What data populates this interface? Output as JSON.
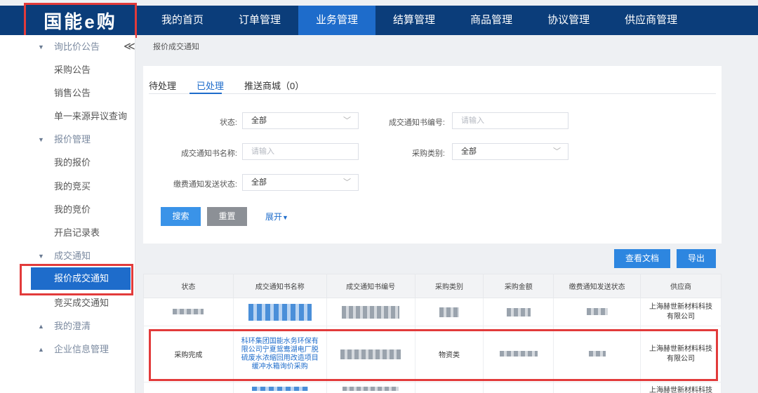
{
  "brand": {
    "logo_text": "国能e购"
  },
  "nav": {
    "items": [
      "我的首页",
      "订单管理",
      "业务管理",
      "结算管理",
      "商品管理",
      "协议管理",
      "供应商管理"
    ],
    "active_index": 2
  },
  "sidebar": {
    "collapse_glyph": "≪",
    "groups": [
      {
        "label": "询比价公告",
        "expanded": true
      },
      {
        "label": "报价管理",
        "expanded": true
      },
      {
        "label": "成交通知",
        "expanded": true
      },
      {
        "label": "我的澄清",
        "expanded": false
      },
      {
        "label": "企业信息管理",
        "expanded": false
      }
    ],
    "items": [
      "采购公告",
      "销售公告",
      "单一来源异议查询",
      "我的报价",
      "我的竞买",
      "我的竞价",
      "开启记录表",
      "报价成交通知",
      "竞买成交通知"
    ],
    "active_item": "报价成交通知"
  },
  "breadcrumb": "报价成交通知",
  "tabs": [
    {
      "label": "待处理"
    },
    {
      "label": "已处理"
    },
    {
      "label": "推送商城（0）"
    }
  ],
  "active_tab_index": 1,
  "filters": {
    "status_label": "状态:",
    "status_value": "全部",
    "notice_no_label": "成交通知书编号:",
    "notice_no_placeholder": "请输入",
    "notice_name_label": "成交通知书名称:",
    "notice_name_placeholder": "请输入",
    "purchase_type_label": "采购类别:",
    "purchase_type_value": "全部",
    "send_status_label": "缴费通知发送状态:",
    "send_status_value": "全部"
  },
  "buttons": {
    "search": "搜索",
    "reset": "重置",
    "expand": "展开",
    "view_doc": "查看文档",
    "export": "导出"
  },
  "table": {
    "headers": [
      "状态",
      "成交通知书名称",
      "成交通知书编号",
      "采购类别",
      "采购金额",
      "缴费通知发送状态",
      "供应商"
    ],
    "rows": [
      {
        "status": "",
        "name": "",
        "number": "",
        "type": "",
        "amount": "",
        "send_status": "",
        "supplier": "上海赫世新材料科技有限公司"
      },
      {
        "status": "采购完成",
        "name": "科环集团国能水务环保有限公司宁夏鸳鸯湖电厂脱硫废水浓缩回用改造项目缓冲水箱询价采购",
        "number": "",
        "type": "物资类",
        "amount": "",
        "send_status": "",
        "supplier": "上海赫世新材料科技有限公司"
      },
      {
        "status": "",
        "name": "",
        "number": "",
        "type": "",
        "amount": "",
        "send_status": "",
        "supplier": "上海赫世新材料科技"
      }
    ]
  },
  "colors": {
    "topbar": "#0b3d7a",
    "accent": "#1e6ccb",
    "highlight_border": "#e23b3b"
  }
}
